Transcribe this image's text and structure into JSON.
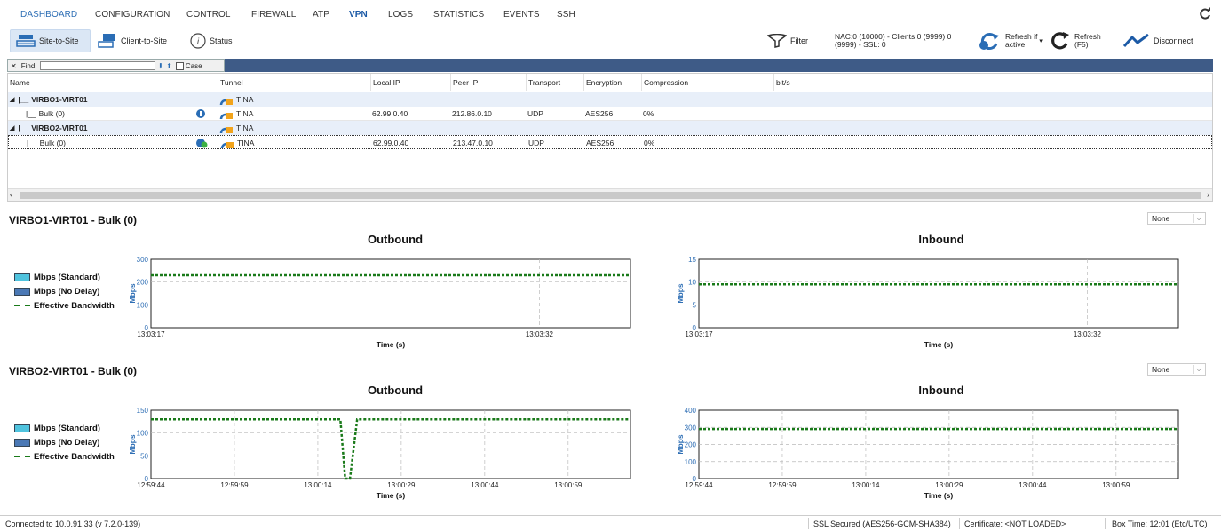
{
  "nav": {
    "items": [
      "DASHBOARD",
      "CONFIGURATION",
      "CONTROL",
      "FIREWALL",
      "ATP",
      "VPN",
      "LOGS",
      "STATISTICS",
      "EVENTS",
      "SSH"
    ]
  },
  "toolbar": {
    "site_to_site": "Site-to-Site",
    "client_to_site": "Client-to-Site",
    "status": "Status",
    "filter": "Filter",
    "nac_line1": "NAC:0 (10000) - Clients:0 (9999) 0",
    "nac_line2": "(9999) - SSL: 0",
    "refresh_if_1": "Refresh if",
    "refresh_if_2": "active",
    "refresh_1": "Refresh",
    "refresh_2": "(F5)",
    "disconnect": "Disconnect"
  },
  "find": {
    "label": "Find:",
    "value": "",
    "case_label": "Case"
  },
  "grid": {
    "columns": [
      "Name",
      "Tunnel",
      "Local IP",
      "Peer IP",
      "Transport",
      "Encryption",
      "Compression",
      "bit/s"
    ],
    "rows": [
      {
        "type": "group",
        "name": "VIRBO1-VIRT01",
        "tunnel": "TINA"
      },
      {
        "type": "sub",
        "name": "Bulk (0)",
        "tunnel": "TINA",
        "local_ip": "62.99.0.40",
        "peer_ip": "212.86.0.10",
        "transport": "UDP",
        "encryption": "AES256",
        "compression": "0%"
      },
      {
        "type": "group",
        "name": "VIRBO2-VIRT01",
        "tunnel": "TINA"
      },
      {
        "type": "sub",
        "name": "Bulk (0)",
        "tunnel": "TINA",
        "local_ip": "62.99.0.40",
        "peer_ip": "213.47.0.10",
        "transport": "UDP",
        "encryption": "AES256",
        "compression": "0%"
      }
    ]
  },
  "sections": [
    {
      "title": "VIRBO1-VIRT01 - Bulk (0)",
      "dropdown": "None"
    },
    {
      "title": "VIRBO2-VIRT01 - Bulk (0)",
      "dropdown": "None"
    }
  ],
  "legend": {
    "standard": "Mbps (Standard)",
    "nodelay": "Mbps (No Delay)",
    "effective": "Effective Bandwidth"
  },
  "colors": {
    "accent": "#1c5aa6",
    "findbar": "#3e5b87",
    "effective": "#1a7a1a",
    "standard": "#4fc3de",
    "nodelay": "#4a78b5",
    "axis_label": "#2f6fb5"
  },
  "chart_data": [
    {
      "type": "line",
      "title": "Outbound",
      "xlabel": "Time (s)",
      "ylabel": "Mbps",
      "x_ticks": [
        "13:03:17",
        "13:03:32"
      ],
      "y_ticks": [
        0,
        100,
        200,
        300
      ],
      "ylim": [
        0,
        300
      ],
      "series": [
        {
          "name": "Effective Bandwidth",
          "x": [
            0,
            1
          ],
          "y": [
            230,
            230
          ]
        }
      ]
    },
    {
      "type": "line",
      "title": "Inbound",
      "xlabel": "Time (s)",
      "ylabel": "Mbps",
      "x_ticks": [
        "13:03:17",
        "13:03:32"
      ],
      "y_ticks": [
        0,
        5,
        10,
        15
      ],
      "ylim": [
        0,
        15
      ],
      "series": [
        {
          "name": "Effective Bandwidth",
          "x": [
            0,
            1
          ],
          "y": [
            9.5,
            9.5
          ]
        }
      ]
    },
    {
      "type": "line",
      "title": "Outbound",
      "xlabel": "Time (s)",
      "ylabel": "Mbps",
      "x_ticks": [
        "12:59:44",
        "12:59:59",
        "13:00:14",
        "13:00:29",
        "13:00:44",
        "13:00:59"
      ],
      "y_ticks": [
        0,
        50,
        100,
        150
      ],
      "ylim": [
        0,
        150
      ],
      "series": [
        {
          "name": "Effective Bandwidth",
          "x": [
            0,
            0.395,
            0.405,
            0.415,
            0.43,
            1
          ],
          "y": [
            130,
            130,
            0,
            0,
            130,
            130
          ]
        }
      ]
    },
    {
      "type": "line",
      "title": "Inbound",
      "xlabel": "Time (s)",
      "ylabel": "Mbps",
      "x_ticks": [
        "12:59:44",
        "12:59:59",
        "13:00:14",
        "13:00:29",
        "13:00:44",
        "13:00:59"
      ],
      "y_ticks": [
        0,
        100,
        200,
        300,
        400
      ],
      "ylim": [
        0,
        400
      ],
      "series": [
        {
          "name": "Effective Bandwidth",
          "x": [
            0,
            1
          ],
          "y": [
            290,
            290
          ]
        }
      ]
    }
  ],
  "status": {
    "connected": "Connected to 10.0.91.33 (v 7.2.0-139)",
    "ssl": "SSL Secured (AES256-GCM-SHA384)",
    "cert": "Certificate: <NOT LOADED>",
    "box_time": "Box Time: 12:01 (Etc/UTC)"
  }
}
